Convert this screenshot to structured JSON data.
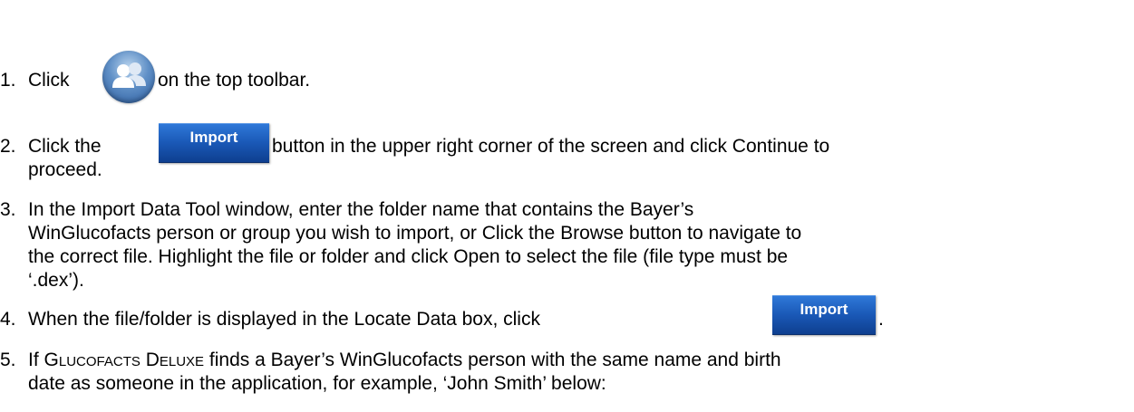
{
  "steps": [
    {
      "number": "1.",
      "before": "Click",
      "after": "on the top toolbar.",
      "icon": "group-users-icon"
    },
    {
      "number": "2.",
      "before": "Click the",
      "button_label": "Import",
      "after": "button in the upper right corner of the screen and click Continue to",
      "line2": "proceed."
    },
    {
      "number": "3.",
      "lines": [
        "In the Import Data Tool window, enter the folder name that contains the Bayer’s",
        "WinGlucofacts person or group you wish to import, or Click the Browse button to navigate to",
        "the correct file. Highlight the file or folder and click Open to select the file (file type must be",
        "‘.dex’)."
      ]
    },
    {
      "number": "4.",
      "before": "When the file/folder is displayed in the Locate Data box, click",
      "button_label": "Import",
      "after": "."
    },
    {
      "number": "5.",
      "prefix": "If",
      "app_name": "Glucofacts Deluxe",
      "line1_rest": "finds a Bayer’s WinGlucofacts person with the same name and birth",
      "line2": "date as someone in the application, for example, ‘John Smith’ below:"
    }
  ],
  "colors": {
    "button": "#1a58b6",
    "icon": "#4f83c0"
  }
}
